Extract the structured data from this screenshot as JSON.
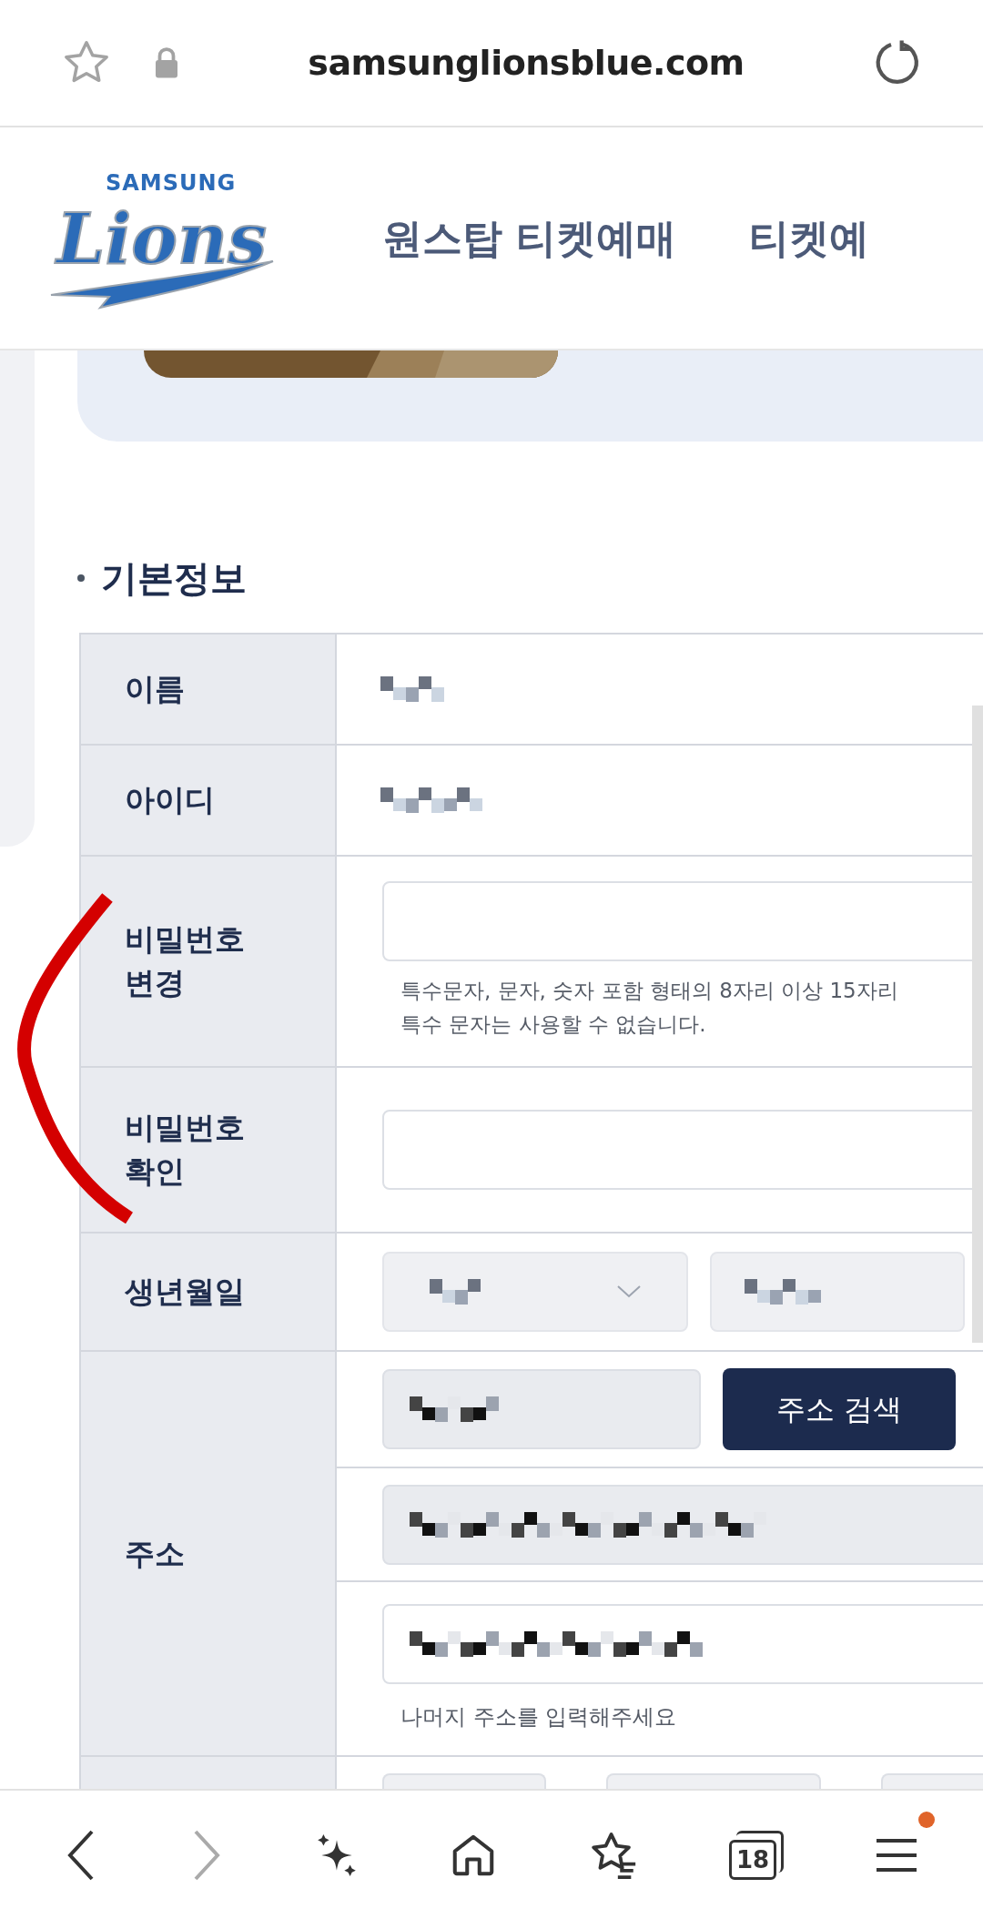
{
  "browser": {
    "url": "samsunglionsblue.com"
  },
  "header": {
    "logo": {
      "wordmark": "SAMSUNG",
      "script": "Lions"
    },
    "nav": [
      "원스탑 티켓예매",
      "티켓예"
    ]
  },
  "section": {
    "title": "기본정보"
  },
  "form": {
    "rows": [
      {
        "kind": "text",
        "label": "이름"
      },
      {
        "kind": "text",
        "label": "아이디"
      },
      {
        "kind": "password",
        "label": "비밀번호\n변경",
        "help": "특수문자, 문자, 숫자 포함 형태의 8자리 이상 15자리\n특수 문자는 사용할 수 없습니다."
      },
      {
        "kind": "password",
        "label": "비밀번호\n확인"
      },
      {
        "kind": "date",
        "label": "생년월일"
      },
      {
        "kind": "address",
        "label": "주소",
        "button": "주소 검색",
        "help": "나머지 주소를 입력해주세요"
      },
      {
        "kind": "partial"
      }
    ]
  },
  "toolbar": {
    "tabs_count": "18",
    "menu_badge": true
  }
}
